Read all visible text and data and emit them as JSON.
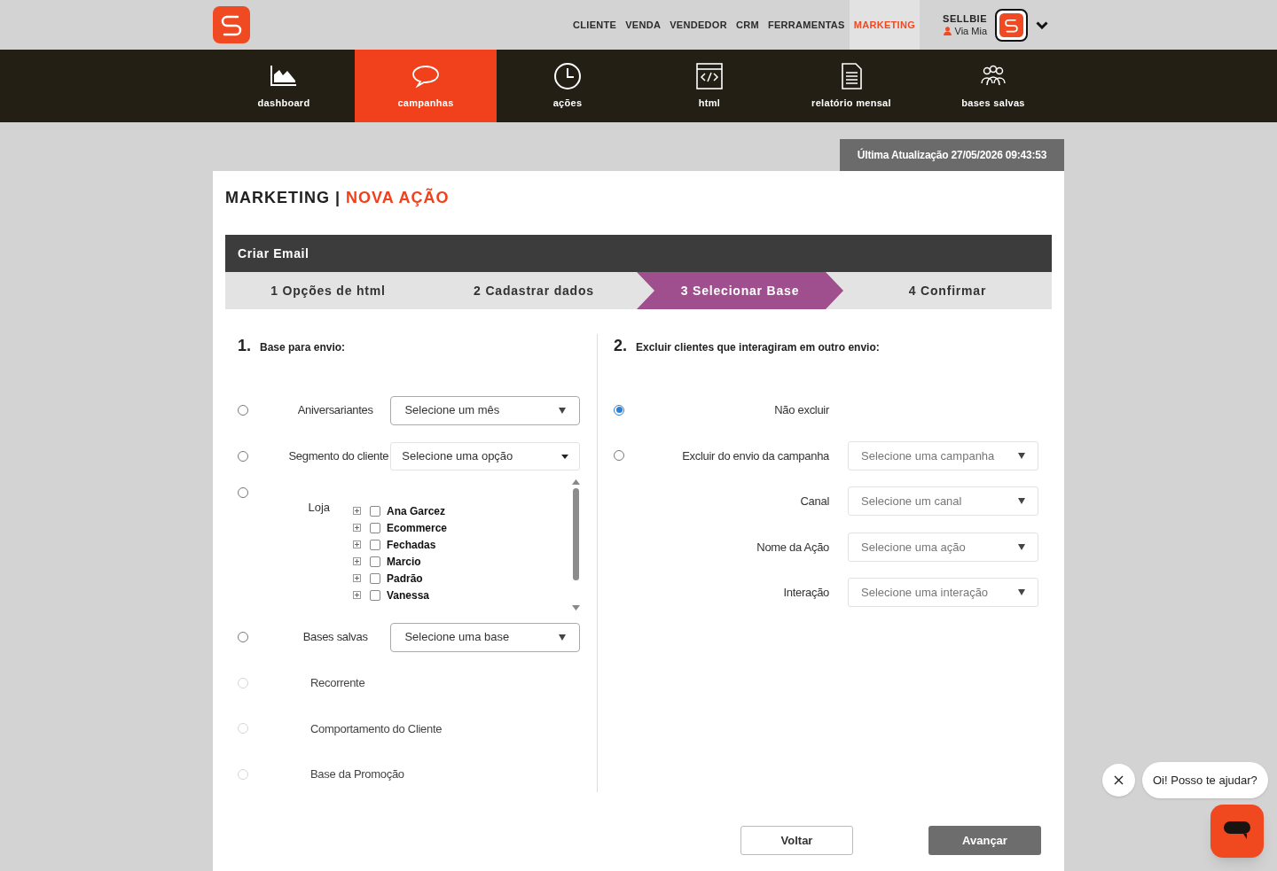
{
  "top_nav": [
    {
      "label": "CLIENTE",
      "selected": false
    },
    {
      "label": "VENDA",
      "selected": false
    },
    {
      "label": "VENDEDOR",
      "selected": false
    },
    {
      "label": "CRM",
      "selected": false
    },
    {
      "label": "FERRAMENTAS",
      "selected": false
    },
    {
      "label": "MARKETING",
      "selected": true
    }
  ],
  "account": {
    "company": "SELLBIE",
    "user": "Via Mia"
  },
  "main_nav": [
    {
      "label": "dashboard",
      "selected": false
    },
    {
      "label": "campanhas",
      "selected": true
    },
    {
      "label": "ações",
      "selected": false
    },
    {
      "label": "html",
      "selected": false
    },
    {
      "label": "relatório mensal",
      "selected": false
    },
    {
      "label": "bases salvas",
      "selected": false
    }
  ],
  "last_update": "Última Atualização 27/05/2026 09:43:53",
  "title": {
    "section": "MARKETING",
    "separator": "|",
    "page": "NOVA AÇÃO"
  },
  "panel_title": "Criar Email",
  "steps": [
    {
      "label": "1 Opções de html",
      "selected": false
    },
    {
      "label": "2 Cadastrar dados",
      "selected": false
    },
    {
      "label": "3 Selecionar Base",
      "selected": true
    },
    {
      "label": "4 Confirmar",
      "selected": false
    }
  ],
  "section_1": {
    "number": "1.",
    "heading": "Base para envio:",
    "options": [
      {
        "kind": "select",
        "label": "Aniversariantes",
        "selected": false,
        "disabled": false,
        "placeholder": "Selecione um mês"
      },
      {
        "kind": "dropdown",
        "label": "Segmento do cliente",
        "selected": false,
        "disabled": false,
        "placeholder": "Selecione uma opção"
      },
      {
        "kind": "tree",
        "label": "Loja",
        "selected": false,
        "disabled": false,
        "items": [
          {
            "label": "Ana Garcez",
            "checked": false,
            "expanded": false
          },
          {
            "label": "Ecommerce",
            "checked": false,
            "expanded": false
          },
          {
            "label": "Fechadas",
            "checked": false,
            "expanded": false
          },
          {
            "label": "Marcio",
            "checked": false,
            "expanded": false
          },
          {
            "label": "Padrão",
            "checked": false,
            "expanded": false
          },
          {
            "label": "Vanessa",
            "checked": false,
            "expanded": false
          }
        ]
      },
      {
        "kind": "select",
        "label": "Bases salvas",
        "selected": false,
        "disabled": false,
        "placeholder": "Selecione uma base"
      },
      {
        "kind": "plain",
        "label": "Recorrente",
        "selected": false,
        "disabled": true
      },
      {
        "kind": "plain",
        "label": "Comportamento do Cliente",
        "selected": false,
        "disabled": true
      },
      {
        "kind": "plain",
        "label": "Base da Promoção",
        "selected": false,
        "disabled": true
      }
    ]
  },
  "section_2": {
    "number": "2.",
    "heading": "Excluir clientes que interagiram em outro envio:",
    "options": [
      {
        "label": "Não excluir",
        "selected": true
      },
      {
        "label": "Excluir do envio da campanha",
        "selected": false,
        "placeholder": "Selecione uma campanha"
      }
    ],
    "fields": [
      {
        "label": "Canal",
        "placeholder": "Selecione um canal"
      },
      {
        "label": "Nome da Ação",
        "placeholder": "Selecione uma ação"
      },
      {
        "label": "Interação",
        "placeholder": "Selecione uma interação"
      }
    ]
  },
  "buttons": {
    "back": "Voltar",
    "next": "Avançar"
  },
  "chat": {
    "message": "Oi! Posso te ajudar?"
  }
}
